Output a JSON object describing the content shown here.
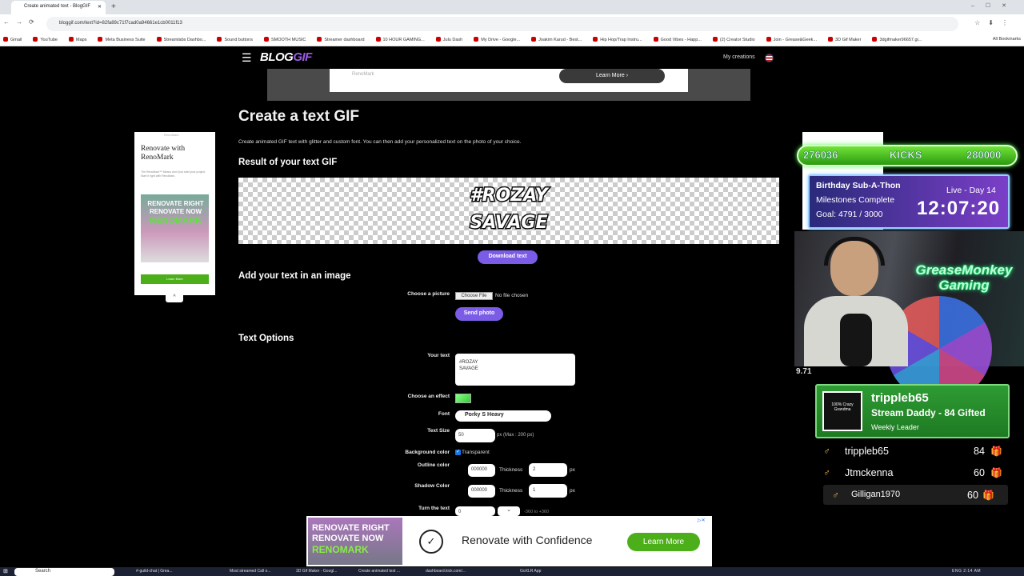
{
  "browser": {
    "tab_title": "Create animated text - BlogGIF",
    "new_tab": "+",
    "url": "bloggif.com/text?id=82fa89c71f7cad0a94661e1cb0011f13",
    "bookmarks": [
      "Gmail",
      "YouTube",
      "Maps",
      "Meta Business Suite",
      "Streamlabs Dashbo...",
      "Sound buttons",
      "SMOOTH MUSIC",
      "Streamer dashboard",
      "10 HOUR GAMING...",
      "Julu Dash",
      "My Drive - Google...",
      "Joakim Karud - Best...",
      "Hip Hop/Trap Instru...",
      "Good Vibes - Happ...",
      "(2) Creator Studio",
      "Join - Grease&Geek...",
      "3D Gif Maker",
      "3dgifmaker96657.gi..."
    ],
    "all_bookmarks": "All Bookmarks"
  },
  "site": {
    "logo_main": "BLOG",
    "logo_accent": "GIF",
    "my_creations": "My creations"
  },
  "top_ad": {
    "brand": "RenoMark",
    "button": "Learn More"
  },
  "main": {
    "title": "Create a text GIF",
    "description": "Create animated GIF text with glitter and custom font. You can then add your personalized text on the photo of your choice.",
    "result_heading": "Result of your text GIF",
    "gif_line1": "#ROZAY",
    "gif_line2": "SAVAGE",
    "download_button": "Download text",
    "add_heading": "Add your text in an image",
    "choose_picture_label": "Choose a picture",
    "choose_file_button": "Choose File",
    "no_file": "No file chosen",
    "send_button": "Send photo",
    "options_heading": "Text Options",
    "your_text_label": "Your text",
    "your_text_value": "#ROZAY\nSAVAGE",
    "effect_label": "Choose an effect",
    "font_label": "Font",
    "font_value": "Porky S Heavy",
    "size_label": "Text Size",
    "size_value": "50",
    "size_hint": "px (Max : 200 px)",
    "bg_label": "Background color",
    "bg_checkbox": "✓",
    "bg_value": "Transparent",
    "outline_label": "Outline color",
    "outline_value": "000000",
    "thickness_label": "Thickness",
    "outline_thickness": "2",
    "px": "px",
    "shadow_label": "Shadow Color",
    "shadow_value": "000000",
    "shadow_thickness": "1",
    "turn_label": "Turn the text",
    "turn_value": "0",
    "turn_hint": "-360 to +360"
  },
  "left_ad": {
    "brand": "RenoMark",
    "title": "Renovate with RenoMark",
    "text": "The RenoMark™ Means don't just start your project. Start it right with RenoMark.",
    "img_line1": "RENOVATE RIGHT RENOVATE NOW",
    "img_line2": "RENOMARK",
    "button": "Learn More",
    "collapse": "^"
  },
  "stream": {
    "kicks_current": "276036",
    "kicks_label": "KICKS",
    "kicks_goal": "280000",
    "subathon_title": "Birthday Sub-A-Thon",
    "milestones": "Milestones Complete",
    "goal": "Goal: 4791 / 3000",
    "live_day": "Live - Day 14",
    "timer": "12:07:20",
    "brand": "GreaseMonkey Gaming",
    "webcam_note": "9.71",
    "leader_avatar": "100% Crazy Grandma",
    "leader_name": "trippleb65",
    "leader_sub": "Stream Daddy - 84 Gifted",
    "leader_weekly": "Weekly Leader",
    "rows": [
      {
        "name": "trippleb65",
        "value": "84"
      },
      {
        "name": "Jtmckenna",
        "value": "60"
      },
      {
        "name": "Gilligan1970",
        "value": "60"
      }
    ],
    "row_icon": "♂",
    "gift_icon": "🎁"
  },
  "bottom_ad": {
    "img_line1": "RENOVATE RIGHT",
    "img_line2": "RENOVATE NOW",
    "img_line3": "RENOMARK",
    "text": "Renovate with Confidence",
    "button": "Learn More"
  },
  "taskbar": {
    "search": "Search",
    "apps": [
      "#-guild-chat | Grea...",
      "Most streamed Call o...",
      "3D Gif Maker - Googl...",
      "Create animated text ...",
      "dashboard.kick.com/...",
      "GoXLR App"
    ],
    "tray": "ENG  2:14 AM"
  }
}
